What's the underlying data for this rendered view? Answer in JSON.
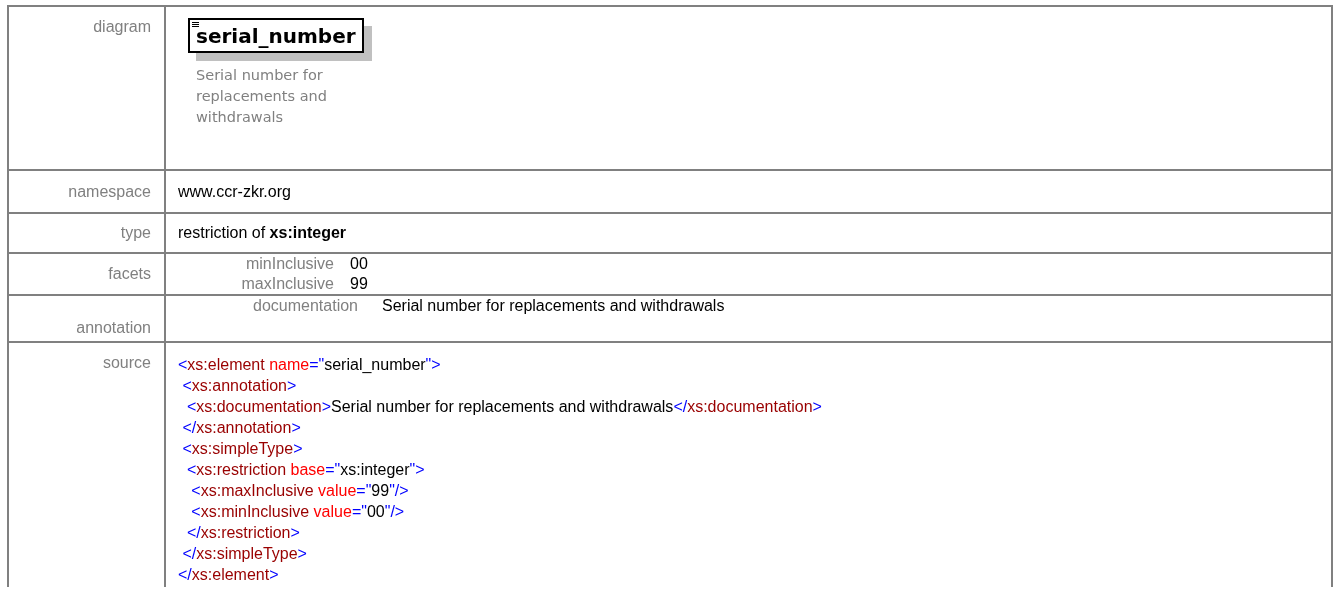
{
  "rows": [
    {
      "kind": "diagram",
      "label": "diagram",
      "element_name": "serial_number",
      "description": "Serial number for replacements and withdrawals"
    },
    {
      "kind": "text",
      "label": "namespace",
      "value": "www.ccr-zkr.org"
    },
    {
      "kind": "text",
      "label": "type",
      "value": "restriction of **xs:integer**"
    },
    {
      "kind": "pairs",
      "label": "facets",
      "pairs": [
        {
          "name": "minInclusive",
          "value": "00"
        },
        {
          "name": "maxInclusive",
          "value": "99"
        }
      ]
    },
    {
      "kind": "pairs",
      "label": "annotation",
      "pairs": [
        {
          "name": "documentation",
          "value": "Serial number for replacements and withdrawals"
        }
      ]
    },
    {
      "kind": "source",
      "label": "source",
      "lines": [
        [
          {
            "kind": "punct",
            "text": "<"
          },
          {
            "kind": "tag",
            "text": "xs:element"
          },
          {
            "kind": "attr",
            "text": " name"
          },
          {
            "kind": "punct",
            "text": "=\""
          },
          {
            "kind": "text",
            "text": "serial_number"
          },
          {
            "kind": "punct",
            "text": "\">"
          }
        ],
        [
          {
            "kind": "punct",
            "text": " <"
          },
          {
            "kind": "tag",
            "text": "xs:annotation"
          },
          {
            "kind": "punct",
            "text": ">"
          }
        ],
        [
          {
            "kind": "punct",
            "text": "  <"
          },
          {
            "kind": "tag",
            "text": "xs:documentation"
          },
          {
            "kind": "punct",
            "text": ">"
          },
          {
            "kind": "text",
            "text": "Serial number for replacements and withdrawals"
          },
          {
            "kind": "punct",
            "text": "</"
          },
          {
            "kind": "tag",
            "text": "xs:documentation"
          },
          {
            "kind": "punct",
            "text": ">"
          }
        ],
        [
          {
            "kind": "punct",
            "text": " </"
          },
          {
            "kind": "tag",
            "text": "xs:annotation"
          },
          {
            "kind": "punct",
            "text": ">"
          }
        ],
        [
          {
            "kind": "punct",
            "text": " <"
          },
          {
            "kind": "tag",
            "text": "xs:simpleType"
          },
          {
            "kind": "punct",
            "text": ">"
          }
        ],
        [
          {
            "kind": "punct",
            "text": "  <"
          },
          {
            "kind": "tag",
            "text": "xs:restriction"
          },
          {
            "kind": "attr",
            "text": " base"
          },
          {
            "kind": "punct",
            "text": "=\""
          },
          {
            "kind": "text",
            "text": "xs:integer"
          },
          {
            "kind": "punct",
            "text": "\">"
          }
        ],
        [
          {
            "kind": "punct",
            "text": "   <"
          },
          {
            "kind": "tag",
            "text": "xs:maxInclusive"
          },
          {
            "kind": "attr",
            "text": " value"
          },
          {
            "kind": "punct",
            "text": "=\""
          },
          {
            "kind": "text",
            "text": "99"
          },
          {
            "kind": "punct",
            "text": "\"/>"
          }
        ],
        [
          {
            "kind": "punct",
            "text": "   <"
          },
          {
            "kind": "tag",
            "text": "xs:minInclusive"
          },
          {
            "kind": "attr",
            "text": " value"
          },
          {
            "kind": "punct",
            "text": "=\""
          },
          {
            "kind": "text",
            "text": "00"
          },
          {
            "kind": "punct",
            "text": "\"/>"
          }
        ],
        [
          {
            "kind": "punct",
            "text": "  </"
          },
          {
            "kind": "tag",
            "text": "xs:restriction"
          },
          {
            "kind": "punct",
            "text": ">"
          }
        ],
        [
          {
            "kind": "punct",
            "text": " </"
          },
          {
            "kind": "tag",
            "text": "xs:simpleType"
          },
          {
            "kind": "punct",
            "text": ">"
          }
        ],
        [
          {
            "kind": "punct",
            "text": "</"
          },
          {
            "kind": "tag",
            "text": "xs:element"
          },
          {
            "kind": "punct",
            "text": ">"
          }
        ]
      ]
    }
  ]
}
